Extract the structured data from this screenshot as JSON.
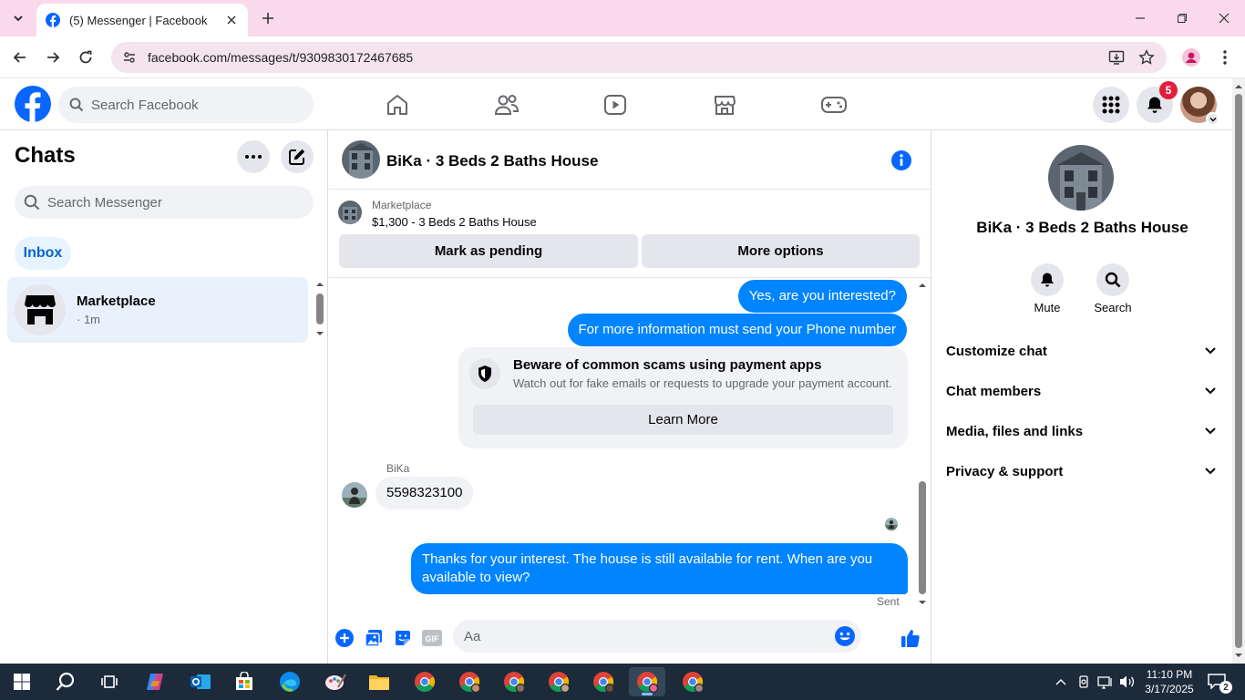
{
  "browser": {
    "tab_title": "(5) Messenger | Facebook",
    "url": "facebook.com/messages/t/9309830172467685"
  },
  "fb_header": {
    "search_placeholder": "Search Facebook",
    "notification_count": "5"
  },
  "left_panel": {
    "title": "Chats",
    "search_placeholder": "Search Messenger",
    "filter_label": "Inbox",
    "chats": [
      {
        "name": "Marketplace",
        "meta": "· 1m"
      }
    ]
  },
  "conversation": {
    "title": "BiKa · 3 Beds 2 Baths House",
    "marketplace_label": "Marketplace",
    "listing": "$1,300 - 3 Beds 2 Baths House",
    "mark_pending_label": "Mark as pending",
    "more_options_label": "More options",
    "messages": {
      "out_1": "Yes, are you interested?",
      "out_2": "For more information must send your Phone number",
      "scam_title": "Beware of common scams using payment apps",
      "scam_desc": "Watch out for fake emails or requests to upgrade your payment account.",
      "learn_more": "Learn More",
      "sender_name": "BiKa",
      "in_1": "5598323100",
      "out_3": "Thanks for your interest. The house is still available for rent. When are you available to view?",
      "status": "Sent"
    },
    "composer_placeholder": "Aa",
    "gif_label": "GIF"
  },
  "right_panel": {
    "name": "BiKa · 3 Beds 2 Baths House",
    "mute_label": "Mute",
    "search_label": "Search",
    "sections": [
      "Customize chat",
      "Chat members",
      "Media, files and links",
      "Privacy & support"
    ]
  },
  "taskbar": {
    "time": "11:10 PM",
    "date": "3/17/2025",
    "notification_count": "2"
  },
  "colors": {
    "facebook_blue": "#0866ff",
    "messenger_blue": "#0084ff",
    "badge_red": "#e41e3f",
    "tab_bar_pink": "#f9d9ea"
  }
}
